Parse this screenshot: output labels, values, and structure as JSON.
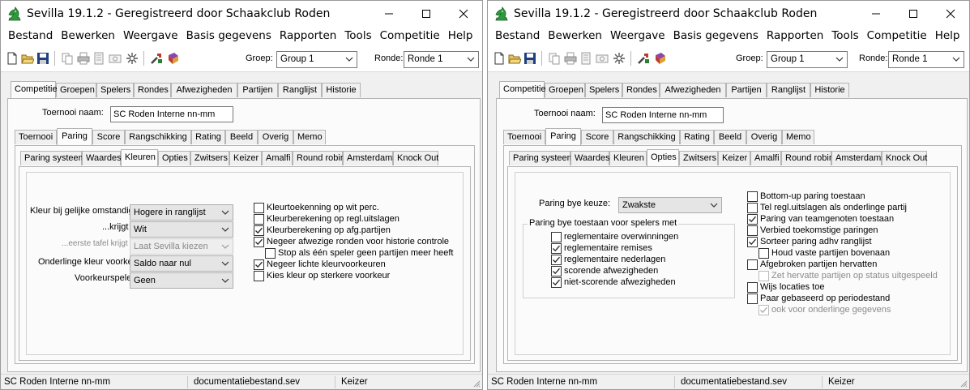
{
  "left_window": {
    "title": "Sevilla 19.1.2 - Geregistreerd door Schaakclub Roden",
    "menu": [
      "Bestand",
      "Bewerken",
      "Weergave",
      "Basis gegevens",
      "Rapporten",
      "Tools",
      "Competitie",
      "Help"
    ],
    "toolbar": {
      "groep_label": "Groep:",
      "groep_value": "Group 1",
      "ronde_label": "Ronde:",
      "ronde_value": "Ronde 1"
    },
    "main_tabs": [
      "Competitie",
      "Groepen",
      "Spelers",
      "Rondes",
      "Afwezigheden",
      "Partijen",
      "Ranglijst",
      "Historie"
    ],
    "toernooi_label": "Toernooi naam:",
    "toernooi_value": "SC Roden Interne nn-mm",
    "sub_tabs": [
      "Toernooi",
      "Paring",
      "Score",
      "Rangschikking",
      "Rating",
      "Beeld",
      "Overig",
      "Memo"
    ],
    "paring_tabs": [
      "Paring systeem",
      "Waardes",
      "Kleuren",
      "Opties",
      "Zwitsers",
      "Keizer",
      "Amalfi",
      "Round robin",
      "Amsterdams",
      "Knock Out"
    ],
    "fields": {
      "kleur_label": "Kleur bij gelijke omstandigh.:",
      "kleur_value": "Hogere in ranglijst",
      "krijgt_label": "...krijgt",
      "krijgt_value": "Wit",
      "eerste_label": "...eerste tafel krijgt",
      "eerste_value": "Laat Sevilla kiezen",
      "onderlinge_label": "Onderlinge kleur voorkeur:",
      "onderlinge_value": "Saldo naar nul",
      "voorkeur_label": "Voorkeurspeler:",
      "voorkeur_value": "Geen"
    },
    "checkboxes": [
      {
        "label": "Kleurtoekenning op wit perc.",
        "checked": false
      },
      {
        "label": "Kleurberekening op regl.uitslagen",
        "checked": false
      },
      {
        "label": "Kleurberekening op afg.partijen",
        "checked": true
      },
      {
        "label": "Negeer afwezige ronden voor historie controle",
        "checked": true
      },
      {
        "label": "Stop als één speler geen partijen meer heeft",
        "checked": false
      },
      {
        "label": "Negeer lichte kleurvoorkeuren",
        "checked": true
      },
      {
        "label": "Kies kleur op sterkere voorkeur",
        "checked": false
      }
    ],
    "status": [
      "SC Roden Interne nn-mm",
      "documentatiebestand.sev",
      "Keizer"
    ]
  },
  "right_window": {
    "title": "Sevilla 19.1.2 - Geregistreerd door Schaakclub Roden",
    "menu": [
      "Bestand",
      "Bewerken",
      "Weergave",
      "Basis gegevens",
      "Rapporten",
      "Tools",
      "Competitie",
      "Help"
    ],
    "toolbar": {
      "groep_label": "Groep:",
      "groep_value": "Group 1",
      "ronde_label": "Ronde:",
      "ronde_value": "Ronde 1"
    },
    "main_tabs": [
      "Competitie",
      "Groepen",
      "Spelers",
      "Rondes",
      "Afwezigheden",
      "Partijen",
      "Ranglijst",
      "Historie"
    ],
    "toernooi_label": "Toernooi naam:",
    "toernooi_value": "SC Roden Interne nn-mm",
    "sub_tabs": [
      "Toernooi",
      "Paring",
      "Score",
      "Rangschikking",
      "Rating",
      "Beeld",
      "Overig",
      "Memo"
    ],
    "paring_tabs": [
      "Paring systeem",
      "Waardes",
      "Kleuren",
      "Opties",
      "Zwitsers",
      "Keizer",
      "Amalfi",
      "Round robin",
      "Amsterdams",
      "Knock Out"
    ],
    "bye_label": "Paring bye keuze:",
    "bye_value": "Zwakste",
    "bye_group_label": "Paring bye toestaan voor spelers met",
    "bye_checkboxes": [
      {
        "label": "reglementaire overwinningen",
        "checked": false
      },
      {
        "label": "reglementaire remises",
        "checked": true
      },
      {
        "label": "reglementaire nederlagen",
        "checked": true
      },
      {
        "label": "scorende afwezigheden",
        "checked": true
      },
      {
        "label": "niet-scorende afwezigheden",
        "checked": true
      }
    ],
    "checkboxes": [
      {
        "label": "Bottom-up paring toestaan",
        "checked": false,
        "disabled": false
      },
      {
        "label": "Tel regl.uitslagen als onderlinge partij",
        "checked": false,
        "disabled": false
      },
      {
        "label": "Paring van teamgenoten toestaan",
        "checked": true,
        "disabled": false
      },
      {
        "label": "Verbied toekomstige paringen",
        "checked": false,
        "disabled": false
      },
      {
        "label": "Sorteer paring adhv ranglijst",
        "checked": true,
        "disabled": false
      },
      {
        "label": "Houd vaste partijen bovenaan",
        "checked": false,
        "disabled": false
      },
      {
        "label": "Afgebroken partijen hervatten",
        "checked": false,
        "disabled": false
      },
      {
        "label": "Zet hervatte partijen op status uitgespeeld",
        "checked": false,
        "disabled": true
      },
      {
        "label": "Wijs locaties toe",
        "checked": false,
        "disabled": false
      },
      {
        "label": "Paar gebaseerd op periodestand",
        "checked": false,
        "disabled": false
      },
      {
        "label": "ook voor onderlinge gegevens",
        "checked": true,
        "disabled": true
      }
    ],
    "status": [
      "SC Roden Interne nn-mm",
      "documentatiebestand.sev",
      "Keizer"
    ]
  }
}
